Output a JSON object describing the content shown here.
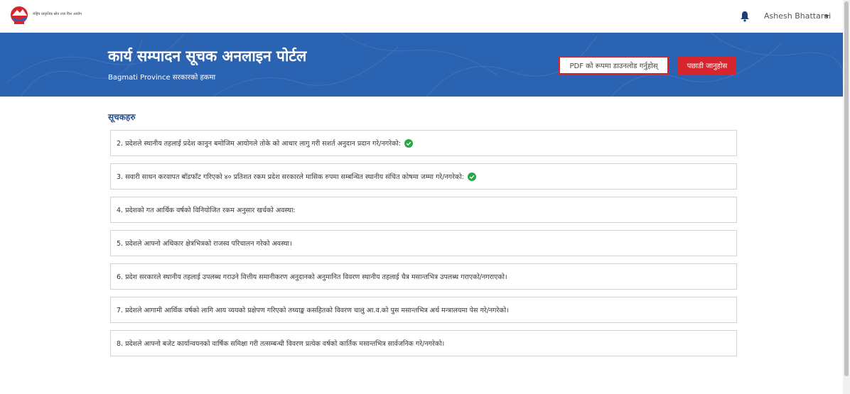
{
  "header": {
    "logo_text": "राष्ट्रिय प्राकृतिक स्रोत तथा वित्त आयोग",
    "user_name": "Ashesh Bhattarai"
  },
  "banner": {
    "title": "कार्य सम्पादन सूचक अनलाइन पोर्टल",
    "subtitle": "Bagmati Province सरकारको हकमा",
    "pdf_button": "PDF को रूपमा डाउनलोड गर्नुहोस्",
    "back_button": "पछाडी जानुहोस"
  },
  "main": {
    "section_title": "सूचकहरु",
    "items": [
      {
        "text": "2. प्रदेशले स्थानीय तहलाई प्रदेश कानुन बमोजिम आयोगले तोके को आधार लागु गरी सशर्त अनुदान प्रदान गरे/नगरेको:",
        "checked": true
      },
      {
        "text": "3. सवारी साधन करवापत बाँडफाँट गरिएको ४० प्रतिशत रकम प्रदेश सरकारले मासिक रुपमा सम्बन्धित स्थानीय संचित कोषमा जम्मा गरे/नगरेको:",
        "checked": true
      },
      {
        "text": "4. प्रदेशको गत आर्थिक वर्षको विनियोजित रकम अनुसार खर्चको अवस्था:",
        "checked": false
      },
      {
        "text": "5. प्रदेशले आफ्नो अधिकार क्षेत्रभित्रको राजस्व परिचालन गरेको अवस्था।",
        "checked": false
      },
      {
        "text": "6. प्रदेश सरकारले स्थानीय तहलाई उपलब्ध गराउने वित्तीय समानीकरण अनुदानको अनुमानित विवरण स्थानीय तहलाई चैत्र मसान्तभित्र उपलब्ध गराएको/नगराएको।",
        "checked": false
      },
      {
        "text": "7. प्रदेशले आगामी आर्थिक वर्षको लागि आय व्ययको प्रक्षेपण गरिएको तथ्याङ्क कसहितको विवरण चालु आ.व.को पुस मसान्तभित्र अर्थ मन्त्रालयमा पेस गरे/नगरेको।",
        "checked": false
      },
      {
        "text": "8. प्रदेशले आफ्नो बजेट कार्यान्वयनको वार्षिक समिक्षा गरी तत्सम्बन्धी विवरण प्रत्येक वर्षको कार्तिक मसान्तभित्र सार्वजनिक गरे/नगरेको।",
        "checked": false
      }
    ]
  },
  "colors": {
    "banner": "#2b63b3",
    "accent_red": "#d6252c",
    "check_green": "#28a745"
  }
}
